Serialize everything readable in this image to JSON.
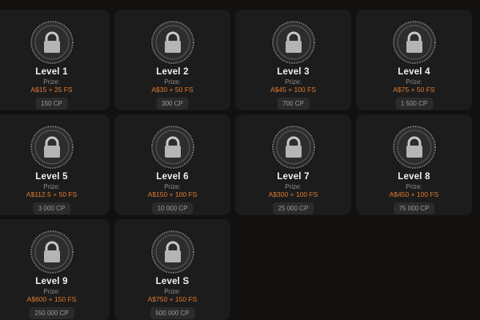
{
  "levels": [
    {
      "title": "Level 1",
      "prize_label": "Prize:",
      "prize": "A$15 + 25 FS",
      "cp": "150 CP"
    },
    {
      "title": "Level 2",
      "prize_label": "Prize:",
      "prize": "A$30 + 50 FS",
      "cp": "300 CP"
    },
    {
      "title": "Level 3",
      "prize_label": "Prize:",
      "prize": "A$45 + 100 FS",
      "cp": "700 CP"
    },
    {
      "title": "Level 4",
      "prize_label": "Prize:",
      "prize": "A$75 + 50 FS",
      "cp": "1 500 CP"
    },
    {
      "title": "Level 5",
      "prize_label": "Prize:",
      "prize": "A$112.5 + 50 FS",
      "cp": "3 000 CP"
    },
    {
      "title": "Level 6",
      "prize_label": "Prize:",
      "prize": "A$150 + 100 FS",
      "cp": "10 000 CP"
    },
    {
      "title": "Level 7",
      "prize_label": "Prize:",
      "prize": "A$300 + 100 FS",
      "cp": "25 000 CP"
    },
    {
      "title": "Level 8",
      "prize_label": "Prize:",
      "prize": "A$450 + 100 FS",
      "cp": "75 000 CP"
    },
    {
      "title": "Level 9",
      "prize_label": "Prize:",
      "prize": "A$600 + 150 FS",
      "cp": "250 000 CP"
    },
    {
      "title": "Level S",
      "prize_label": "Prize:",
      "prize": "A$750 + 150 FS",
      "cp": "500 000 CP"
    }
  ],
  "colors": {
    "background": "#121110",
    "card": "#1d1c1c",
    "prize": "#e07b2f",
    "title": "#f1f1f1"
  },
  "icons": {
    "badge": "padlock-icon"
  }
}
